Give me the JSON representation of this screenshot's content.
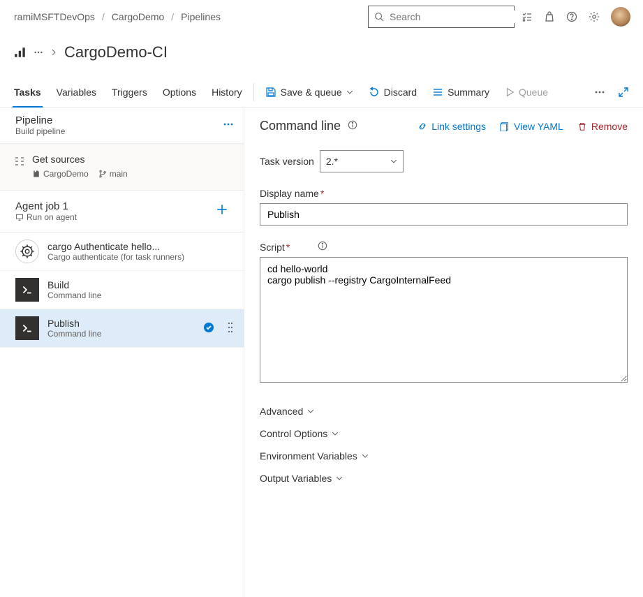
{
  "breadcrumbs": [
    "ramiMSFTDevOps",
    "CargoDemo",
    "Pipelines"
  ],
  "search_placeholder": "Search",
  "page_title": "CargoDemo-CI",
  "tabs": [
    "Tasks",
    "Variables",
    "Triggers",
    "Options",
    "History"
  ],
  "active_tab": "Tasks",
  "commands": {
    "save_queue": "Save & queue",
    "discard": "Discard",
    "summary": "Summary",
    "queue": "Queue"
  },
  "pipeline": {
    "title": "Pipeline",
    "subtitle": "Build pipeline"
  },
  "get_sources": {
    "label": "Get sources",
    "repo": "CargoDemo",
    "branch": "main"
  },
  "agent_job": {
    "title": "Agent job 1",
    "subtitle": "Run on agent"
  },
  "tasks": [
    {
      "title": "cargo Authenticate hello...",
      "subtitle": "Cargo authenticate (for task runners)",
      "icon": "rust"
    },
    {
      "title": "Build",
      "subtitle": "Command line",
      "icon": "cmd"
    },
    {
      "title": "Publish",
      "subtitle": "Command line",
      "icon": "cmd",
      "selected": true,
      "checked": true
    }
  ],
  "detail": {
    "heading": "Command line",
    "links": {
      "link_settings": "Link settings",
      "view_yaml": "View YAML",
      "remove": "Remove"
    },
    "task_version_label": "Task version",
    "task_version_value": "2.*",
    "display_name_label": "Display name",
    "display_name_value": "Publish",
    "script_label": "Script",
    "script_value": "cd hello-world\ncargo publish --registry CargoInternalFeed",
    "sections": [
      "Advanced",
      "Control Options",
      "Environment Variables",
      "Output Variables"
    ]
  }
}
